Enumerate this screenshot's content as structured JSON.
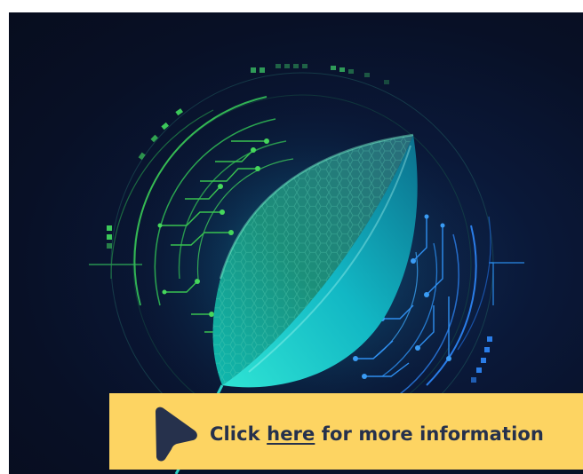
{
  "banner": {
    "prefix": "Click ",
    "link_label": "here",
    "suffix": " for more information"
  },
  "colors": {
    "background": "#081026",
    "banner": "#fdd462",
    "banner_text": "#26314c",
    "leaf": "#1ec9c4",
    "circuit_green": "#37c24a",
    "circuit_blue": "#2a7de8"
  },
  "icons": {
    "cursor": "pointer-arrow-icon",
    "leaf": "leaf-illustration",
    "circuit": "circuit-ring-decoration"
  }
}
